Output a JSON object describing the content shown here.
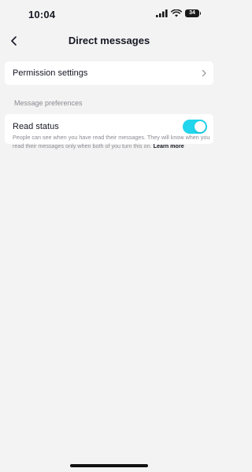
{
  "status_bar": {
    "time": "10:04",
    "battery_level": "34",
    "icons": [
      "cellular-signal-icon",
      "wifi-icon",
      "battery-icon"
    ]
  },
  "nav": {
    "title": "Direct messages",
    "back_icon": "chevron-left-icon"
  },
  "permission_row": {
    "label": "Permission settings",
    "icon": "chevron-right-icon"
  },
  "message_preferences": {
    "section_title": "Message preferences",
    "read_status": {
      "label": "Read status",
      "enabled": true,
      "description": "People can see when you have read their messages. They will know when you read their messages only when both of you turn this on.",
      "link_text": "Learn more"
    }
  },
  "colors": {
    "background": "#f3f3f3",
    "card": "#ffffff",
    "toggle_on": "#20d5ec",
    "secondary_text": "#8a8b91",
    "primary_text": "#161823"
  }
}
